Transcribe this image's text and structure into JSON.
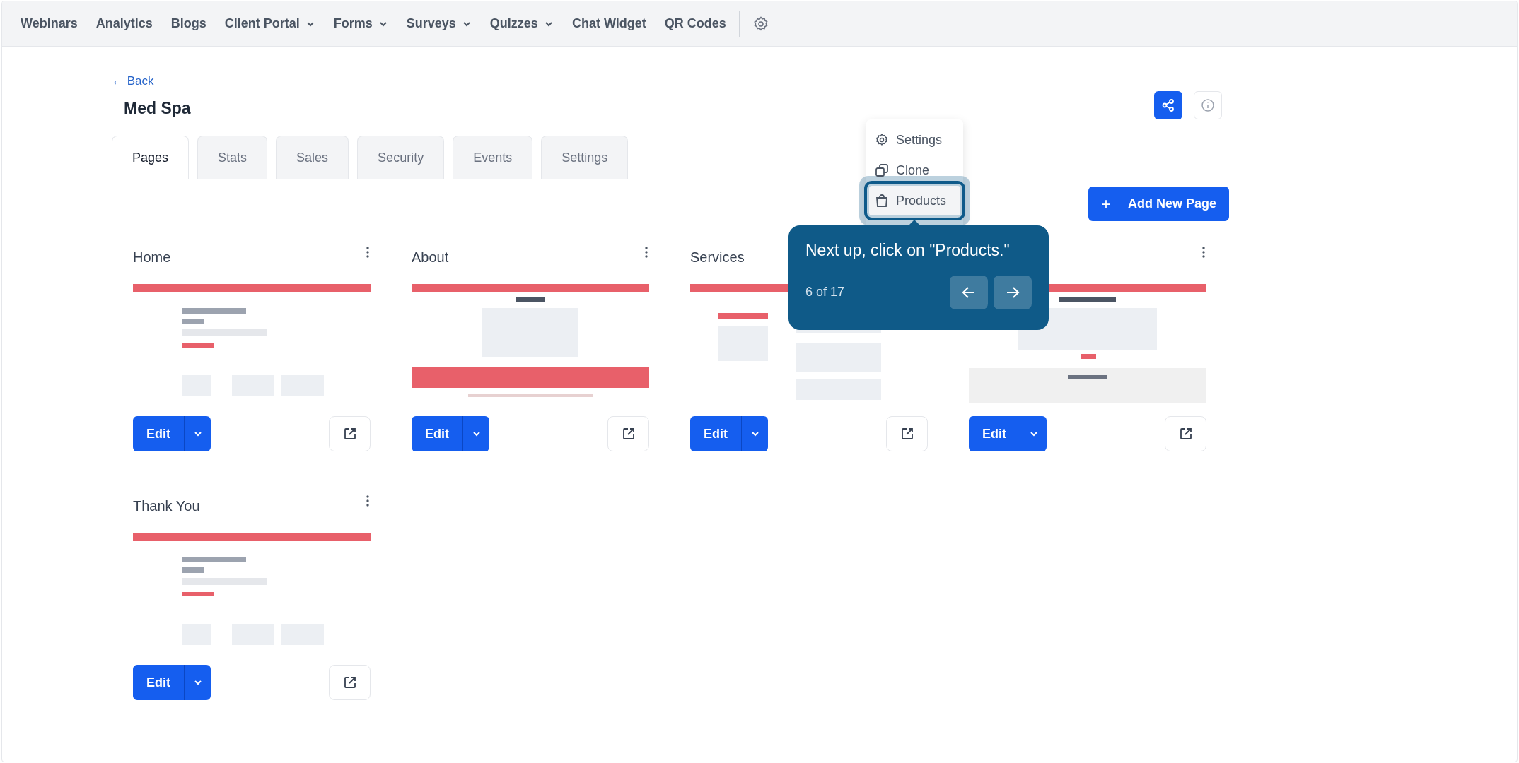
{
  "top_nav": {
    "items": [
      {
        "label": "Webinars",
        "dropdown": false
      },
      {
        "label": "Analytics",
        "dropdown": false
      },
      {
        "label": "Blogs",
        "dropdown": false
      },
      {
        "label": "Client Portal",
        "dropdown": true
      },
      {
        "label": "Forms",
        "dropdown": true
      },
      {
        "label": "Surveys",
        "dropdown": true
      },
      {
        "label": "Quizzes",
        "dropdown": true
      },
      {
        "label": "Chat Widget",
        "dropdown": false
      },
      {
        "label": "QR Codes",
        "dropdown": false
      }
    ]
  },
  "header": {
    "back": "← Back",
    "title": "Med Spa"
  },
  "tabs": [
    {
      "label": "Pages",
      "selected": true
    },
    {
      "label": "Stats",
      "selected": false
    },
    {
      "label": "Sales",
      "selected": false
    },
    {
      "label": "Security",
      "selected": false
    },
    {
      "label": "Events",
      "selected": false
    },
    {
      "label": "Settings",
      "selected": false
    }
  ],
  "add_button": {
    "icon": "+",
    "label": "Add New Page"
  },
  "menu": {
    "items": [
      {
        "kind": "settings",
        "label": "Settings",
        "highlighted": false
      },
      {
        "kind": "clone",
        "label": "Clone",
        "highlighted": false
      },
      {
        "kind": "products",
        "label": "Products",
        "highlighted": true
      }
    ]
  },
  "tour": {
    "text": "Next up, click on \"Products.\"",
    "step": "6 of 17"
  },
  "pages": [
    {
      "title": "Home",
      "menu": true,
      "edit": "Edit"
    },
    {
      "title": "About",
      "menu": true,
      "edit": "Edit"
    },
    {
      "title": "Services",
      "menu": false,
      "edit": "Edit"
    },
    {
      "menu": true,
      "edit": "Edit"
    },
    {
      "title": "Thank You",
      "menu": true,
      "edit": "Edit"
    }
  ]
}
